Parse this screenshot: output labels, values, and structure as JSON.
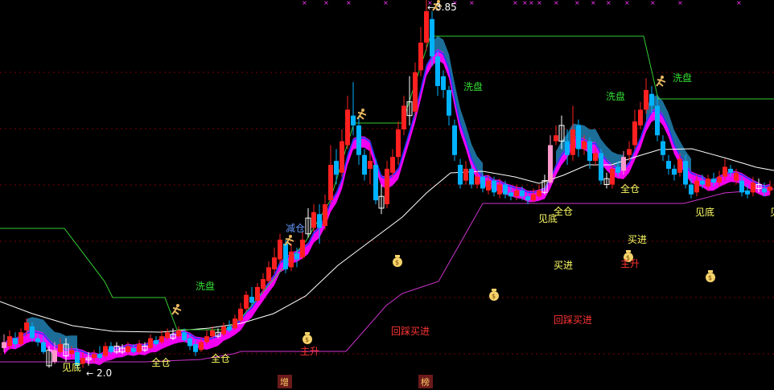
{
  "chart_data": {
    "type": "candlestick",
    "price_label": "3.85",
    "low_label": "2.0",
    "colors": {
      "up": "#ff2020",
      "down": "#00b2ff",
      "grid": "#7a0000",
      "band": "#ff00ff",
      "cloud": "#1f7aa8",
      "ma_white": "#ffffff",
      "ma_blue": "#1a3cff",
      "support": "#cc33cc",
      "stop": "#33cc33",
      "text_green": "#33dd33",
      "text_yellow": "#ffff66",
      "text_red": "#ff3333",
      "text_blue": "#6699ff"
    },
    "annotations": [
      {
        "text": "洗盘",
        "color": "text_green"
      },
      {
        "text": "洗盘",
        "color": "text_green"
      },
      {
        "text": "洗盘",
        "color": "text_green"
      },
      {
        "text": "洗盘",
        "color": "text_green"
      },
      {
        "text": "减仓",
        "color": "text_blue"
      },
      {
        "text": "全仓",
        "color": "text_yellow"
      },
      {
        "text": "全仓",
        "color": "text_yellow"
      },
      {
        "text": "全仓",
        "color": "text_yellow"
      },
      {
        "text": "全仓",
        "color": "text_yellow"
      },
      {
        "text": "见底",
        "color": "text_yellow"
      },
      {
        "text": "见底",
        "color": "text_yellow"
      },
      {
        "text": "见底",
        "color": "text_yellow"
      },
      {
        "text": "见底",
        "color": "text_yellow"
      },
      {
        "text": "买进",
        "color": "text_yellow"
      },
      {
        "text": "买进",
        "color": "text_yellow"
      },
      {
        "text": "回踩买进",
        "color": "text_red"
      },
      {
        "text": "回踩买进",
        "color": "text_red"
      },
      {
        "text": "主升",
        "color": "text_red"
      },
      {
        "text": "主升",
        "color": "text_red"
      }
    ],
    "bottom_tags": [
      "增",
      "榜"
    ]
  }
}
